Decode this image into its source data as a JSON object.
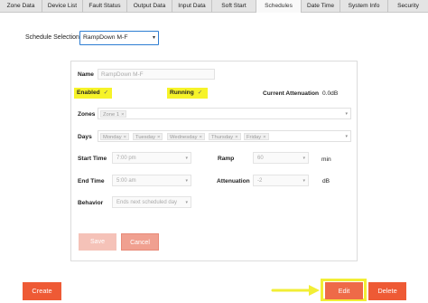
{
  "tabs": [
    {
      "label": "Zone Data",
      "active": false
    },
    {
      "label": "Device List",
      "active": false
    },
    {
      "label": "Fault Status",
      "active": false
    },
    {
      "label": "Output Data",
      "active": false
    },
    {
      "label": "Input Data",
      "active": false
    },
    {
      "label": "Soft Start",
      "active": false
    },
    {
      "label": "Schedules",
      "active": true
    },
    {
      "label": "Date Time",
      "active": false
    },
    {
      "label": "System Info",
      "active": false
    },
    {
      "label": "Security",
      "active": false
    }
  ],
  "schedule_selection": {
    "label": "Schedule Selection:",
    "value": "RampDown M-F"
  },
  "form": {
    "name_label": "Name",
    "name_value": "RampDown M-F",
    "enabled_label": "Enabled",
    "enabled_checked": true,
    "running_label": "Running",
    "running_checked": true,
    "current_attenuation_label": "Current Attenuation",
    "current_attenuation_value": "0.0dB",
    "zones_label": "Zones",
    "zones": [
      "Zone 1"
    ],
    "days_label": "Days",
    "days": [
      "Monday",
      "Tuesday",
      "Wednesday",
      "Thursday",
      "Friday"
    ],
    "start_time_label": "Start Time",
    "start_time_value": "7:00 pm",
    "ramp_label": "Ramp",
    "ramp_value": "60",
    "ramp_unit": "min",
    "end_time_label": "End Time",
    "end_time_value": "5:00 am",
    "attenuation_label": "Attenuation",
    "attenuation_value": "-2",
    "attenuation_unit": "dB",
    "behavior_label": "Behavior",
    "behavior_value": "Ends next scheduled day",
    "save_label": "Save",
    "cancel_label": "Cancel"
  },
  "footer": {
    "create_label": "Create",
    "edit_label": "Edit",
    "delete_label": "Delete"
  },
  "icons": {
    "check": "✓",
    "remove": "×",
    "caret": "▾"
  },
  "colors": {
    "accent": "#ee5a35",
    "highlight": "#f6f329",
    "focus": "#2d7dd2"
  }
}
